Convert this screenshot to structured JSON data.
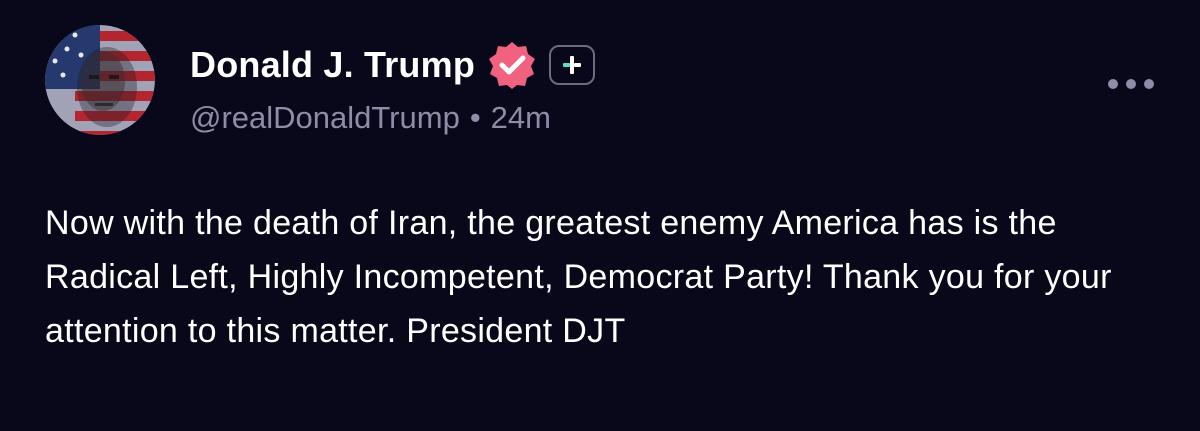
{
  "author": {
    "display_name": "Donald J. Trump",
    "handle": "@realDonaldTrump",
    "time_ago": "24m",
    "separator": "•",
    "avatar_icon": "avatar-flag-portrait",
    "verified_icon": "verified-badge-icon",
    "verified_color": "#f0627f",
    "plus_icon": "plus-icon"
  },
  "post": {
    "text": "Now with the death of Iran, the greatest enemy America has is the Radical Left, Highly Incompetent, Democrat Party! Thank you for your attention to this matter. President DJT"
  },
  "actions": {
    "more_icon": "more-horizontal-icon"
  },
  "colors": {
    "background": "#09081a",
    "text_primary": "#ffffff",
    "text_secondary": "#8e8ca6",
    "plus_accent": "#5de0c7"
  }
}
